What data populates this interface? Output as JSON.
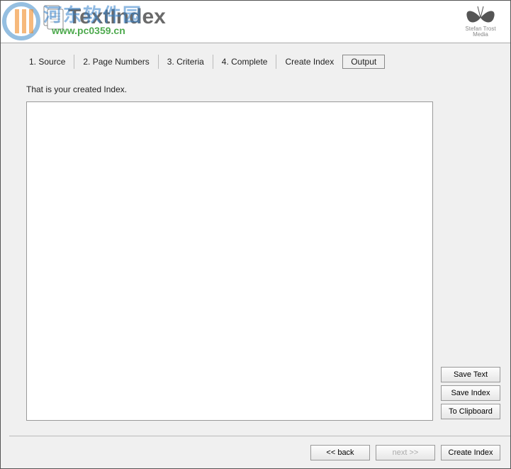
{
  "header": {
    "app_title": "TextIndex",
    "brand_line1": "Stefan Trost",
    "brand_line2": "Media"
  },
  "watermark": {
    "cn": "河东软件园",
    "url": "www.pc0359.cn"
  },
  "tabs": {
    "t0": "1. Source",
    "t1": "2. Page Numbers",
    "t2": "3. Criteria",
    "t3": "4. Complete",
    "create": "Create Index",
    "output": "Output"
  },
  "main": {
    "message": "That is your created Index.",
    "output_value": ""
  },
  "side": {
    "save_text": "Save Text",
    "save_index": "Save Index",
    "to_clipboard": "To Clipboard"
  },
  "footer": {
    "back": "<< back",
    "next": "next >>",
    "create_index": "Create Index"
  }
}
